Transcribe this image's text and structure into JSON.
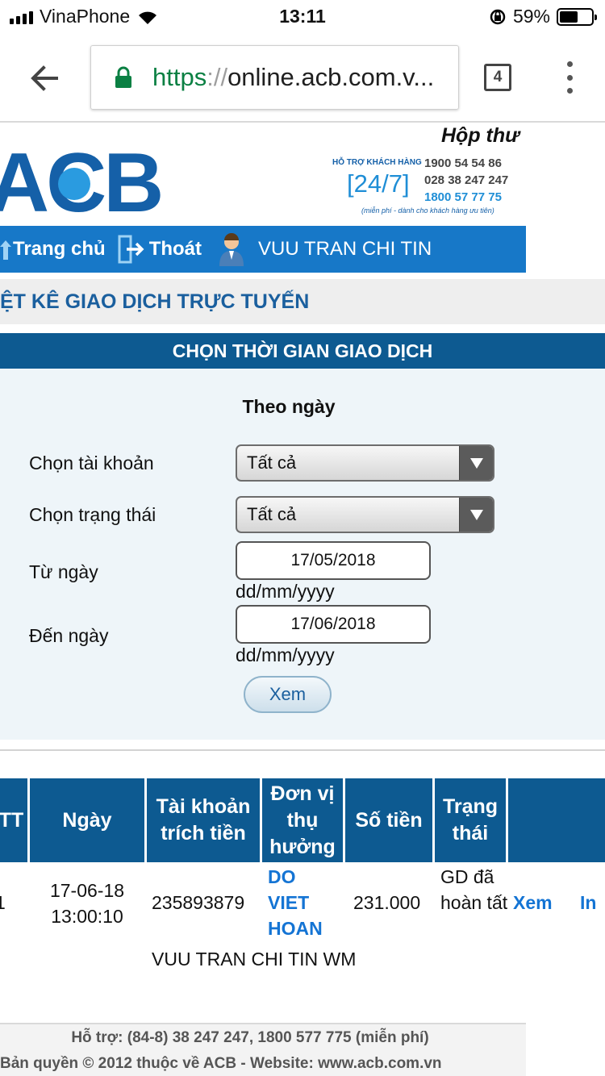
{
  "status_bar": {
    "carrier": "VinaPhone",
    "time": "13:11",
    "battery": "59%",
    "battery_level": 0.59
  },
  "browser": {
    "url_scheme": "https",
    "url_sep": "://",
    "url_host": "online.acb.com.v...",
    "tab_count": "4"
  },
  "header": {
    "logo_text": "ACB",
    "mailbox": "Hộp thư",
    "hotline_label": "HỖ TRỢ KHÁCH HÀNG",
    "hotline_247": "[24/7]",
    "hotline_numbers": [
      "1900 54 54 86",
      "028 38 247 247",
      "1800 57 77 75"
    ],
    "hotline_note": "(miễn phí - dành cho khách hàng ưu tiên)"
  },
  "nav": {
    "home": "Trang chủ",
    "exit": "Thoát",
    "user": "VUU TRAN CHI TIN"
  },
  "page_title": "ỆT KÊ GIAO DỊCH TRỰC TUYẾN",
  "filter": {
    "section_title": "CHỌN THỜI GIAN GIAO DỊCH",
    "mode": "Theo ngày",
    "account_label": "Chọn tài khoản",
    "account_value": "Tất cả",
    "status_label": "Chọn trạng thái",
    "status_value": "Tất cả",
    "from_label": "Từ ngày",
    "from_value": "17/05/2018",
    "to_label": "Đến ngày",
    "to_value": "17/06/2018",
    "date_hint": "dd/mm/yyyy",
    "view_button": "Xem"
  },
  "table": {
    "headers": [
      "TT",
      "Ngày",
      "Tài khoản trích tiền",
      "Đơn vị thụ hưởng",
      "Số tiền",
      "Trạng thái"
    ],
    "rows": [
      {
        "index": "1",
        "date": "17-06-18",
        "time": "13:00:10",
        "account": "235893879",
        "beneficiary": "DO VIET HOAN",
        "amount": "231.000",
        "status": "GD đã hoàn tất",
        "view_link": "Xem",
        "print_link": "In",
        "description": "VUU TRAN CHI TIN WM"
      }
    ]
  },
  "footer": {
    "support": "Hỗ trợ: (84-8) 38 247 247, 1800 577 775 (miễn phí)",
    "copyright": "Bản quyền © 2012 thuộc về ACB - Website: www.acb.com.vn"
  },
  "colors": {
    "brand_blue": "#1778c8",
    "header_blue": "#0d5a91",
    "link_blue": "#1474d4",
    "url_green": "#0b8043"
  }
}
